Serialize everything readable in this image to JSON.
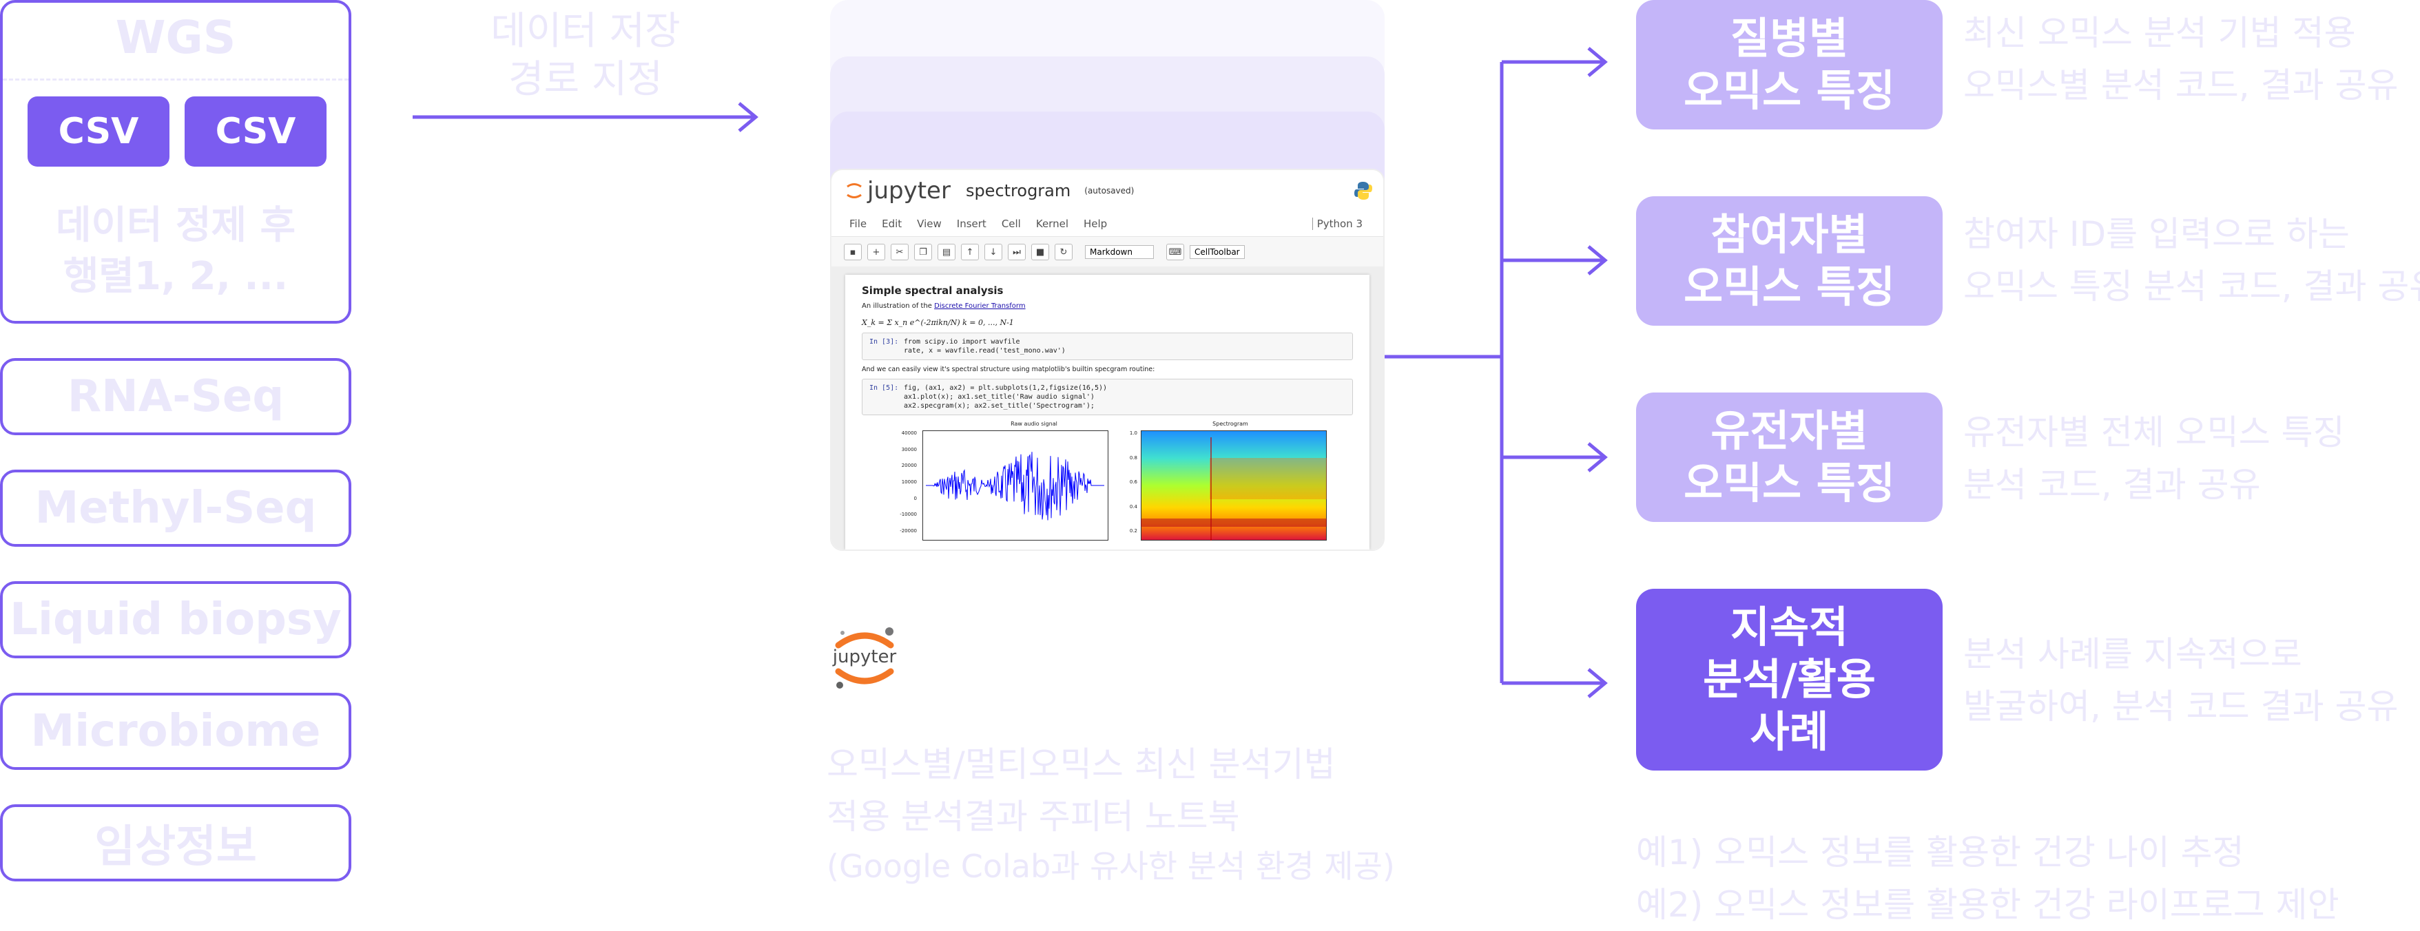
{
  "colors": {
    "accent": "#7b5cf0",
    "accent_light": "#c4b5f9",
    "faint_text": "#ebe8fb"
  },
  "left": {
    "wgs": {
      "title": "WGS",
      "csv1": "CSV",
      "csv2": "CSV",
      "caption_line1": "데이터 정제 후",
      "caption_line2": "행렬1, 2, ..."
    },
    "sources": [
      "RNA-Seq",
      "Methyl-Seq",
      "Liquid biopsy",
      "Microbiome",
      "임상정보"
    ]
  },
  "arrow_label": {
    "line1": "데이터 저장",
    "line2": "경로 지정"
  },
  "notebook": {
    "logo": "jupyter",
    "title": "spectrogram",
    "status": "(autosaved)",
    "kernel": "Python 3",
    "menu": [
      "File",
      "Edit",
      "View",
      "Insert",
      "Cell",
      "Kernel",
      "Help"
    ],
    "cell_type": "Markdown",
    "celltoolbar": "CellToolbar",
    "heading": "Simple spectral analysis",
    "intro": "An illustration of the",
    "intro_link": "Discrete Fourier Transform",
    "formula": "X_k = Σ x_n e^(-2πikn/N)   k = 0, ..., N-1",
    "cell1_prompt": "In [3]:",
    "cell1_code": [
      "from scipy.io import wavfile",
      "rate, x = wavfile.read('test_mono.wav')"
    ],
    "text2": "And we can easily view it's spectral structure using matplotlib's builtin specgram routine:",
    "cell2_prompt": "In [5]:",
    "cell2_code": [
      "fig, (ax1, ax2) = plt.subplots(1,2,figsize(16,5))",
      "ax1.plot(x); ax1.set_title('Raw audio signal')",
      "ax2.specgram(x); ax2.set_title('Spectrogram');"
    ],
    "plot1_title": "Raw audio signal",
    "plot2_title": "Spectrogram",
    "plot1_yticks": [
      "40000",
      "30000",
      "20000",
      "10000",
      "0",
      "-10000",
      "-20000"
    ],
    "plot2_yticks": [
      "1.0",
      "0.8",
      "0.6",
      "0.4",
      "0.2"
    ]
  },
  "jupyter_logo_text": "jupyter",
  "notebook_caption": {
    "line1": "오믹스별/멀티오믹스 최신 분석기법",
    "line2": "적용 분석결과 주피터 노트북",
    "line3": "(Google Colab과 유사한 분석 환경 제공)"
  },
  "outputs": [
    {
      "line1": "질병별",
      "line2": "오믹스 특징",
      "line3": "",
      "desc1": "최신 오믹스 분석 기법 적용",
      "desc2": "오믹스별 분석 코드, 결과 공유"
    },
    {
      "line1": "참여자별",
      "line2": "오믹스 특징",
      "line3": "",
      "desc1": "참여자 ID를 입력으로 하는",
      "desc2": "오믹스 특징 분석 코드, 결과 공유"
    },
    {
      "line1": "유전자별",
      "line2": "오믹스 특징",
      "line3": "",
      "desc1": "유전자별 전체 오믹스 특징",
      "desc2": "분석 코드, 결과 공유"
    },
    {
      "line1": "지속적",
      "line2": "분석/활용",
      "line3": "사례",
      "desc1": "분석 사례를 지속적으로",
      "desc2": "발굴하여, 분석 코드 결과 공유"
    }
  ],
  "examples": {
    "line1": "예1) 오믹스 정보를 활용한 건강 나이 추정",
    "line2": "예2) 오믹스 정보를 활용한 건강 라이프로그 제안"
  }
}
